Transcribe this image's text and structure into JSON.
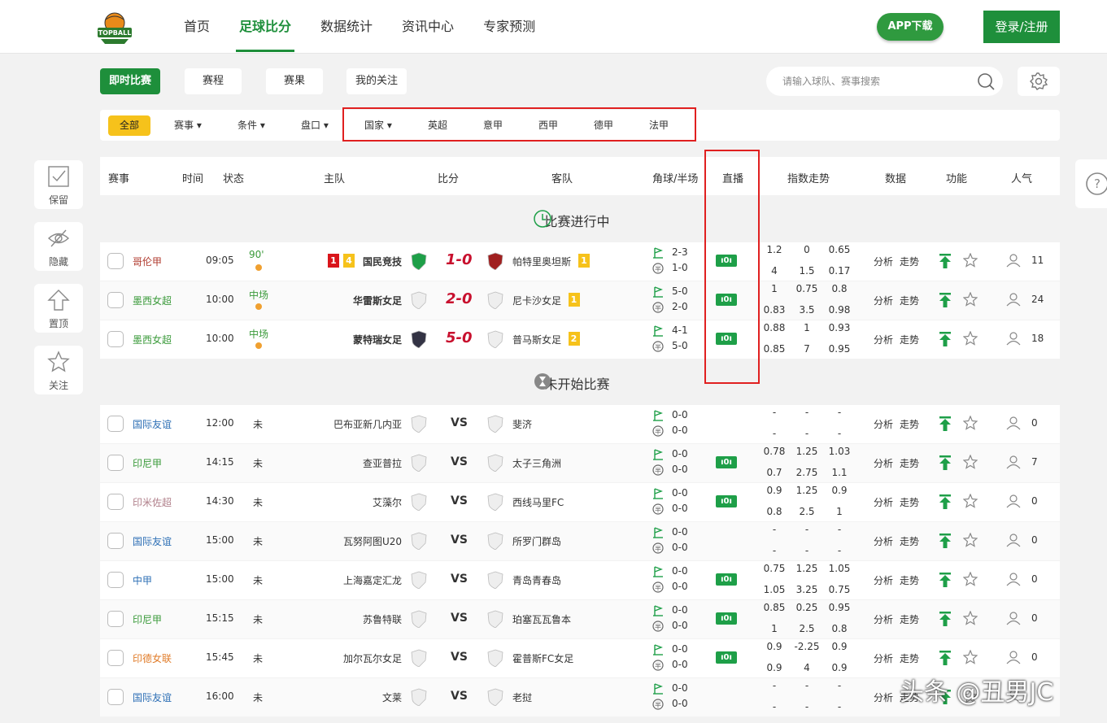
{
  "header": {
    "logo_text": "TOPBALL",
    "nav": [
      {
        "label": "首页"
      },
      {
        "label": "足球比分",
        "active": true
      },
      {
        "label": "数据统计"
      },
      {
        "label": "资讯中心"
      },
      {
        "label": "专家预测"
      }
    ],
    "app_download": "APP下载",
    "login": "登录/注册"
  },
  "tabs": [
    {
      "label": "即时比赛",
      "active": true
    },
    {
      "label": "赛程"
    },
    {
      "label": "赛果"
    },
    {
      "label": "我的关注"
    }
  ],
  "search": {
    "placeholder": "请输入球队、赛事搜索"
  },
  "filters": {
    "all": "全部",
    "items": [
      "赛事 ▾",
      "条件 ▾",
      "盘口 ▾",
      "国家 ▾",
      "英超",
      "意甲",
      "西甲",
      "德甲",
      "法甲"
    ]
  },
  "sidebar": [
    {
      "label": "保留",
      "icon": "check-icon"
    },
    {
      "label": "隐藏",
      "icon": "eye-off-icon"
    },
    {
      "label": "置顶",
      "icon": "arrow-up-icon"
    },
    {
      "label": "关注",
      "icon": "star-icon"
    }
  ],
  "table_headers": [
    "赛事",
    "时间",
    "状态",
    "主队",
    "比分",
    "客队",
    "角球/半场",
    "直播",
    "指数走势",
    "数据",
    "功能",
    "人气"
  ],
  "sections": {
    "live": "比赛进行中",
    "upcoming": "未开始比赛"
  },
  "labels": {
    "analysis": "分析",
    "trend": "走势",
    "live_badge": "ı0ı"
  },
  "colors": {
    "brand_green": "#1e8f3b",
    "live_green": "#1e9f48",
    "score_red": "#c8102e",
    "highlight_red": "#e02020",
    "all_yellow": "#f6c21b"
  },
  "live_matches": [
    {
      "league": "哥伦甲",
      "league_color": "#b03a2e",
      "time": "09:05",
      "status": "90'",
      "home": "国民竞技",
      "home_cards": [
        "1",
        "4"
      ],
      "score": "1-0",
      "away": "帕特里奥坦斯",
      "away_cards": [
        "1"
      ],
      "corner": "2-3",
      "half": "1-0",
      "live": true,
      "odds": [
        "1.2",
        "0",
        "0.65",
        "4",
        "1.5",
        "0.17"
      ],
      "pop": "11"
    },
    {
      "league": "墨西女超",
      "league_color": "#3a9a3a",
      "time": "10:00",
      "status": "中场",
      "home": "华雷斯女足",
      "home_cards": [],
      "score": "2-0",
      "away": "尼卡沙女足",
      "away_cards": [
        "1"
      ],
      "corner": "5-0",
      "half": "2-0",
      "live": true,
      "odds": [
        "1",
        "0.75",
        "0.8",
        "0.83",
        "3.5",
        "0.98"
      ],
      "pop": "24"
    },
    {
      "league": "墨西女超",
      "league_color": "#3a9a3a",
      "time": "10:00",
      "status": "中场",
      "home": "蒙特瑞女足",
      "home_cards": [],
      "score": "5-0",
      "away": "普马斯女足",
      "away_cards": [
        "2"
      ],
      "corner": "4-1",
      "half": "5-0",
      "live": true,
      "odds": [
        "0.88",
        "1",
        "0.93",
        "0.85",
        "7",
        "0.95"
      ],
      "pop": "18"
    }
  ],
  "upcoming_matches": [
    {
      "league": "国际友谊",
      "league_color": "#2d6fb5",
      "time": "12:00",
      "status": "未",
      "home": "巴布亚新几内亚",
      "away": "斐济",
      "corner": "0-0",
      "half": "0-0",
      "live": false,
      "odds": [
        "-",
        "-",
        "-",
        "-",
        "-",
        "-"
      ],
      "pop": "0"
    },
    {
      "league": "印尼甲",
      "league_color": "#3a9a3a",
      "time": "14:15",
      "status": "未",
      "home": "查亚普拉",
      "away": "太子三角洲",
      "corner": "0-0",
      "half": "0-0",
      "live": true,
      "odds": [
        "0.78",
        "1.25",
        "1.03",
        "0.7",
        "2.75",
        "1.1"
      ],
      "pop": "7"
    },
    {
      "league": "印米佐超",
      "league_color": "#b07f8a",
      "time": "14:30",
      "status": "未",
      "home": "艾藻尔",
      "away": "西线马里FC",
      "corner": "0-0",
      "half": "0-0",
      "live": true,
      "odds": [
        "0.9",
        "1.25",
        "0.9",
        "0.8",
        "2.5",
        "1"
      ],
      "pop": "0"
    },
    {
      "league": "国际友谊",
      "league_color": "#2d6fb5",
      "time": "15:00",
      "status": "未",
      "home": "瓦努阿图U20",
      "away": "所罗门群岛",
      "corner": "0-0",
      "half": "0-0",
      "live": false,
      "odds": [
        "-",
        "-",
        "-",
        "-",
        "-",
        "-"
      ],
      "pop": "0"
    },
    {
      "league": "中甲",
      "league_color": "#2d6fb5",
      "time": "15:00",
      "status": "未",
      "home": "上海嘉定汇龙",
      "away": "青岛青春岛",
      "corner": "0-0",
      "half": "0-0",
      "live": true,
      "odds": [
        "0.75",
        "1.25",
        "1.05",
        "1.05",
        "3.25",
        "0.75"
      ],
      "pop": "0"
    },
    {
      "league": "印尼甲",
      "league_color": "#3a9a3a",
      "time": "15:15",
      "status": "未",
      "home": "苏鲁特联",
      "away": "珀塞瓦瓦鲁本",
      "corner": "0-0",
      "half": "0-0",
      "live": true,
      "odds": [
        "0.85",
        "0.25",
        "0.95",
        "1",
        "2.5",
        "0.8"
      ],
      "pop": "0"
    },
    {
      "league": "印德女联",
      "league_color": "#e07b28",
      "time": "15:45",
      "status": "未",
      "home": "加尔瓦尔女足",
      "away": "霍普斯FC女足",
      "corner": "0-0",
      "half": "0-0",
      "live": true,
      "odds": [
        "0.9",
        "-2.25",
        "0.9",
        "0.9",
        "4",
        "0.9"
      ],
      "pop": "0"
    },
    {
      "league": "国际友谊",
      "league_color": "#2d6fb5",
      "time": "16:00",
      "status": "未",
      "home": "文莱",
      "away": "老挝",
      "corner": "0-0",
      "half": "0-0",
      "live": false,
      "odds": [
        "-",
        "-",
        "-",
        "-",
        "-",
        "-"
      ],
      "pop": ""
    }
  ],
  "watermark": "头条 @丑男JC"
}
